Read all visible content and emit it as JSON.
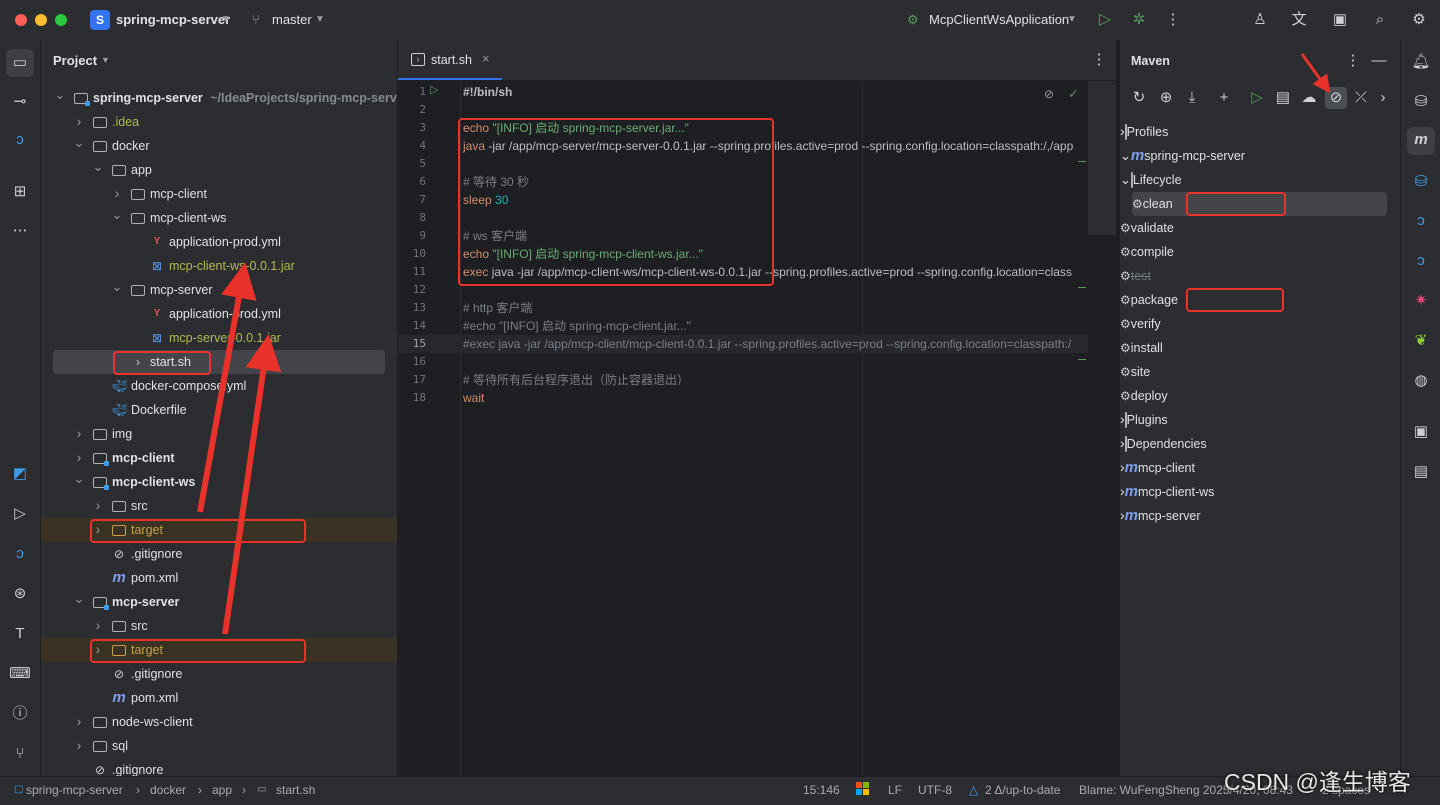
{
  "titlebar": {
    "project_badge": "S",
    "project_name": "spring-mcp-server",
    "branch": "master",
    "run_config": "McpClientWsApplication"
  },
  "project_panel": {
    "title": "Project",
    "tree": [
      {
        "label": "spring-mcp-server",
        "suffix": " ~/IdeaProjects/spring-mcp-server",
        "depth": 0,
        "chev": "open",
        "icon": "module-folder",
        "bold": true
      },
      {
        "label": ".idea",
        "depth": 1,
        "chev": "closed",
        "icon": "folder",
        "color": "#b5b74f"
      },
      {
        "label": "docker",
        "depth": 1,
        "chev": "open",
        "icon": "folder"
      },
      {
        "label": "app",
        "depth": 2,
        "chev": "open",
        "icon": "folder"
      },
      {
        "label": "mcp-client",
        "depth": 3,
        "chev": "closed",
        "icon": "folder"
      },
      {
        "label": "mcp-client-ws",
        "depth": 3,
        "chev": "open",
        "icon": "folder"
      },
      {
        "label": "application-prod.yml",
        "depth": 4,
        "chev": "none",
        "icon": "yaml"
      },
      {
        "label": "mcp-client-ws-0.0.1.jar",
        "depth": 4,
        "chev": "none",
        "icon": "jar",
        "color": "#b5b74f"
      },
      {
        "label": "mcp-server",
        "depth": 3,
        "chev": "open",
        "icon": "folder"
      },
      {
        "label": "application-prod.yml",
        "depth": 4,
        "chev": "none",
        "icon": "yaml"
      },
      {
        "label": "mcp-server-0.0.1.jar",
        "depth": 4,
        "chev": "none",
        "icon": "jar",
        "color": "#b5b74f"
      },
      {
        "label": "start.sh",
        "depth": 3,
        "chev": "none",
        "icon": "shell",
        "selected": true
      },
      {
        "label": "docker-compose.yml",
        "depth": 2,
        "chev": "none",
        "icon": "docker"
      },
      {
        "label": "Dockerfile",
        "depth": 2,
        "chev": "none",
        "icon": "docker"
      },
      {
        "label": "img",
        "depth": 1,
        "chev": "closed",
        "icon": "folder"
      },
      {
        "label": "mcp-client",
        "depth": 1,
        "chev": "closed",
        "icon": "module-folder",
        "bold": true
      },
      {
        "label": "mcp-client-ws",
        "depth": 1,
        "chev": "open",
        "icon": "module-folder",
        "bold": true
      },
      {
        "label": "src",
        "depth": 2,
        "chev": "closed",
        "icon": "folder"
      },
      {
        "label": "target",
        "depth": 2,
        "chev": "closed",
        "icon": "target-folder",
        "color": "#c8a04a",
        "excluded": true
      },
      {
        "label": ".gitignore",
        "depth": 2,
        "chev": "none",
        "icon": "ignore"
      },
      {
        "label": "pom.xml",
        "depth": 2,
        "chev": "none",
        "icon": "maven"
      },
      {
        "label": "mcp-server",
        "depth": 1,
        "chev": "open",
        "icon": "module-folder",
        "bold": true
      },
      {
        "label": "src",
        "depth": 2,
        "chev": "closed",
        "icon": "folder"
      },
      {
        "label": "target",
        "depth": 2,
        "chev": "closed",
        "icon": "target-folder",
        "color": "#c8a04a",
        "excluded": true
      },
      {
        "label": ".gitignore",
        "depth": 2,
        "chev": "none",
        "icon": "ignore"
      },
      {
        "label": "pom.xml",
        "depth": 2,
        "chev": "none",
        "icon": "maven"
      },
      {
        "label": "node-ws-client",
        "depth": 1,
        "chev": "closed",
        "icon": "folder"
      },
      {
        "label": "sql",
        "depth": 1,
        "chev": "closed",
        "icon": "folder"
      },
      {
        "label": ".gitignore",
        "depth": 1,
        "chev": "none",
        "icon": "ignore"
      }
    ]
  },
  "editor": {
    "tab_label": "start.sh",
    "current_line": 15,
    "lines": [
      [
        {
          "t": "#!/bin/sh",
          "c": "#bcbec4",
          "b": true
        }
      ],
      [],
      [
        {
          "t": "echo ",
          "c": "#cf8e6d"
        },
        {
          "t": "\"[INFO] 启动 spring-mcp-server.jar...\"",
          "c": "#6aab73"
        }
      ],
      [
        {
          "t": "java",
          "c": "#cf8e6d"
        },
        {
          "t": " -jar /app/mcp-server/mcp-server-0.0.1.jar --spring.profiles.active=prod --spring.config.location=classpath:/,/app",
          "c": "#bcbec4"
        }
      ],
      [],
      [
        {
          "t": "# 等待 30 秒",
          "c": "#7a7e85"
        }
      ],
      [
        {
          "t": "sleep ",
          "c": "#cf8e6d"
        },
        {
          "t": "30",
          "c": "#2aacb8"
        }
      ],
      [],
      [
        {
          "t": "# ws 客户端",
          "c": "#7a7e85"
        }
      ],
      [
        {
          "t": "echo ",
          "c": "#cf8e6d"
        },
        {
          "t": "\"[INFO] 启动 spring-mcp-client-ws.jar...\"",
          "c": "#6aab73"
        }
      ],
      [
        {
          "t": "exec",
          "c": "#cf8e6d"
        },
        {
          "t": " java -jar /app/mcp-client-ws/mcp-client-ws-0.0.1.jar --spring.profiles.active=prod --spring.config.location=class",
          "c": "#bcbec4"
        }
      ],
      [],
      [
        {
          "t": "# http 客户端",
          "c": "#7a7e85"
        }
      ],
      [
        {
          "t": "#echo \"[INFO] 启动 spring-mcp-client.jar...\"",
          "c": "#7a7e85"
        }
      ],
      [
        {
          "t": "#exec java -jar /app/mcp-client/mcp-client-0.0.1.jar --spring.profiles.active=prod --spring.config.location=classpath:/",
          "c": "#7a7e85"
        }
      ],
      [],
      [
        {
          "t": "# 等待所有后台程序退出（防止容器退出）",
          "c": "#7a7e85"
        }
      ],
      [
        {
          "t": "wait",
          "c": "#cf8e6d"
        }
      ]
    ]
  },
  "maven": {
    "title": "Maven",
    "tree": [
      {
        "label": "Profiles",
        "depth": 0,
        "chev": "closed",
        "icon": "folder"
      },
      {
        "label": "spring-mcp-server",
        "depth": 0,
        "chev": "open",
        "icon": "maven"
      },
      {
        "label": "Lifecycle",
        "depth": 1,
        "chev": "open",
        "icon": "folder"
      },
      {
        "label": "clean",
        "depth": 2,
        "chev": "none",
        "icon": "gear",
        "selected": true
      },
      {
        "label": "validate",
        "depth": 2,
        "chev": "none",
        "icon": "gear"
      },
      {
        "label": "compile",
        "depth": 2,
        "chev": "none",
        "icon": "gear"
      },
      {
        "label": "test",
        "depth": 2,
        "chev": "none",
        "icon": "gear",
        "skipped": true
      },
      {
        "label": "package",
        "depth": 2,
        "chev": "none",
        "icon": "gear"
      },
      {
        "label": "verify",
        "depth": 2,
        "chev": "none",
        "icon": "gear"
      },
      {
        "label": "install",
        "depth": 2,
        "chev": "none",
        "icon": "gear"
      },
      {
        "label": "site",
        "depth": 2,
        "chev": "none",
        "icon": "gear"
      },
      {
        "label": "deploy",
        "depth": 2,
        "chev": "none",
        "icon": "gear"
      },
      {
        "label": "Plugins",
        "depth": 1,
        "chev": "closed",
        "icon": "folder"
      },
      {
        "label": "Dependencies",
        "depth": 1,
        "chev": "closed",
        "icon": "folder"
      },
      {
        "label": "mcp-client",
        "depth": 0,
        "chev": "closed",
        "icon": "maven"
      },
      {
        "label": "mcp-client-ws",
        "depth": 0,
        "chev": "closed",
        "icon": "maven"
      },
      {
        "label": "mcp-server",
        "depth": 0,
        "chev": "closed",
        "icon": "maven"
      }
    ]
  },
  "statusbar": {
    "breadcrumbs": [
      "spring-mcp-server",
      "docker",
      "app",
      "start.sh"
    ],
    "position": "15:146",
    "line_sep": "LF",
    "encoding": "UTF-8",
    "vcs": "2 Δ/up-to-date",
    "blame": "Blame: WuFengSheng 2025/4/20, 08:43",
    "indent": "2 spaces"
  },
  "watermark": "CSDN @逢生博客",
  "colors": {
    "accent": "#3574f0",
    "annotation": "#e8322a",
    "target": "#c8a04a",
    "jar": "#b5b74f"
  }
}
